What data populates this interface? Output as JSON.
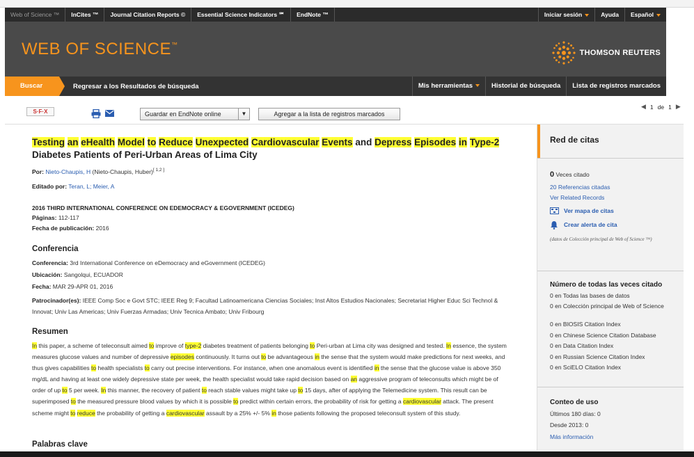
{
  "topbar": {
    "items": [
      "Web of Science ™",
      "InCites ™",
      "Journal Citation Reports ©",
      "Essential Science Indicators ℠",
      "EndNote ™"
    ],
    "signin": "Iniciar sesión",
    "help": "Ayuda",
    "language": "Español"
  },
  "banner": {
    "logo": "WEB OF SCIENCE",
    "logo_tm": "™",
    "brand": "THOMSON REUTERS"
  },
  "nav": {
    "search": "Buscar",
    "back": "Regresar a los Resultados de búsqueda",
    "tools": "Mis herramientas",
    "history": "Historial de búsqueda",
    "marked": "Lista de registros marcados"
  },
  "toolbar": {
    "sfx": "S·F·X",
    "save_select": "Guardar en EndNote online",
    "add_marked": "Agregar a la lista de registros marcados",
    "page_current": "1",
    "page_of": "de",
    "page_total": "1"
  },
  "record": {
    "title_parts": [
      {
        "t": "Testing",
        "hl": true
      },
      {
        "t": " ",
        "hl": false
      },
      {
        "t": "an",
        "hl": true
      },
      {
        "t": " ",
        "hl": false
      },
      {
        "t": "eHealth",
        "hl": true
      },
      {
        "t": " ",
        "hl": false
      },
      {
        "t": "Model",
        "hl": true
      },
      {
        "t": " ",
        "hl": false
      },
      {
        "t": "to",
        "hl": true
      },
      {
        "t": " ",
        "hl": false
      },
      {
        "t": "Reduce",
        "hl": true
      },
      {
        "t": " ",
        "hl": false
      },
      {
        "t": "Unexpected",
        "hl": true
      },
      {
        "t": " ",
        "hl": false
      },
      {
        "t": "Cardiovascular",
        "hl": true
      },
      {
        "t": " ",
        "hl": false
      },
      {
        "t": "Events",
        "hl": true
      },
      {
        "t": " and ",
        "hl": false
      },
      {
        "t": "Depress",
        "hl": true
      },
      {
        "t": " ",
        "hl": false
      },
      {
        "t": "Episodes",
        "hl": true
      },
      {
        "t": " ",
        "hl": false
      },
      {
        "t": "in",
        "hl": true
      },
      {
        "t": " ",
        "hl": false
      },
      {
        "t": "Type-2",
        "hl": true
      },
      {
        "t": " Diabetes Patients of Peri-Urban Areas of Lima City",
        "hl": false
      }
    ],
    "by_label": "Por:",
    "author": "Nieto-Chaupis, H",
    "author_full": "(Nieto-Chaupis, Huber)",
    "author_sup": "[ 1,2 ]",
    "edited_label": "Editado por:",
    "editors": "Teran, L; Meier, A",
    "conference_name": "2016 THIRD INTERNATIONAL CONFERENCE ON EDEMOCRACY & EGOVERNMENT (ICEDEG)",
    "pages_label": "Páginas:",
    "pages": "112-117",
    "pubdate_label": "Fecha de publicación:",
    "pubdate": "2016"
  },
  "conference": {
    "heading": "Conferencia",
    "conf_label": "Conferencia:",
    "conf_value": "3rd International Conference on eDemocracy and eGovernment (ICEDEG)",
    "location_label": "Ubicación:",
    "location_value": "Sangolqui, ECUADOR",
    "date_label": "Fecha:",
    "date_value": "MAR 29-APR 01, 2016",
    "sponsor_label": "Patrocinador(es):",
    "sponsor_value": "IEEE Comp Soc e Govt STC; IEEE Reg 9; Facultad Latinoamericana Ciencias Sociales; Inst Altos Estudios Nacionales; Secretariat Higher Educ Sci Technol & Innovat; Univ Las Americas; Univ Fuerzas Armadas; Univ Tecnica Ambato; Univ Fribourg"
  },
  "abstract": {
    "heading": "Resumen",
    "parts": [
      {
        "t": "In",
        "hl": true
      },
      {
        "t": " this paper, a scheme of teleconsult aimed ",
        "hl": false
      },
      {
        "t": "to",
        "hl": true
      },
      {
        "t": " improve of ",
        "hl": false
      },
      {
        "t": "type-2",
        "hl": true
      },
      {
        "t": " diabetes treatment of patients belonging ",
        "hl": false
      },
      {
        "t": "to",
        "hl": true
      },
      {
        "t": " Peri-urban at Lima city was designed and tested. ",
        "hl": false
      },
      {
        "t": "In",
        "hl": true
      },
      {
        "t": " essence, the system measures glucose values and number of depressive ",
        "hl": false
      },
      {
        "t": "episodes",
        "hl": true
      },
      {
        "t": " continuously. It turns out ",
        "hl": false
      },
      {
        "t": "to",
        "hl": true
      },
      {
        "t": " be advantageous ",
        "hl": false
      },
      {
        "t": "in",
        "hl": true
      },
      {
        "t": " the sense that the system would make predictions for next weeks, and thus gives capabilities ",
        "hl": false
      },
      {
        "t": "to",
        "hl": true
      },
      {
        "t": " health specialists ",
        "hl": false
      },
      {
        "t": "to",
        "hl": true
      },
      {
        "t": " carry out precise interventions. For instance, when one anomalous event is identified ",
        "hl": false
      },
      {
        "t": "in",
        "hl": true
      },
      {
        "t": " the sense that the glucose value is above 350 mg/dL and having at least one widely depressive state per week, the health specialist would take rapid decision based on ",
        "hl": false
      },
      {
        "t": "an",
        "hl": true
      },
      {
        "t": " aggressive program of teleconsults which might be of order of up ",
        "hl": false
      },
      {
        "t": "to",
        "hl": true
      },
      {
        "t": " 5 per week. ",
        "hl": false
      },
      {
        "t": "In",
        "hl": true
      },
      {
        "t": " this manner, the recovery of patient ",
        "hl": false
      },
      {
        "t": "to",
        "hl": true
      },
      {
        "t": " reach stable values might take up ",
        "hl": false
      },
      {
        "t": "to",
        "hl": true
      },
      {
        "t": " 15 days, after of applying the Telemedicine system. This result can be superimposed ",
        "hl": false
      },
      {
        "t": "to",
        "hl": true
      },
      {
        "t": " the measured pressure blood values by which it is possible ",
        "hl": false
      },
      {
        "t": "to",
        "hl": true
      },
      {
        "t": " predict within certain errors, the probability of risk for getting a ",
        "hl": false
      },
      {
        "t": "cardiovascular",
        "hl": true
      },
      {
        "t": " attack. The present scheme might ",
        "hl": false
      },
      {
        "t": "to",
        "hl": true
      },
      {
        "t": " ",
        "hl": false
      },
      {
        "t": "reduce",
        "hl": true
      },
      {
        "t": " the probability of getting a ",
        "hl": false
      },
      {
        "t": "cardiovascular",
        "hl": true
      },
      {
        "t": " assault by a 25% +/- 5% ",
        "hl": false
      },
      {
        "t": "in",
        "hl": true
      },
      {
        "t": " those patients following the proposed teleconsult system of this study.",
        "hl": false
      }
    ]
  },
  "keywords": {
    "heading": "Palabras clave"
  },
  "sidebar": {
    "heading": "Red de citas",
    "times_cited_count": "0",
    "times_cited_label": "Veces citado",
    "cited_refs": "20 Referencias citadas",
    "related": "Ver Related Records",
    "citation_map": "Ver mapa de citas",
    "alert": "Crear alerta de cita",
    "note": "(datos de Colección principal de Web of Science ™)",
    "all_cited_heading": "Número de todas las veces citado",
    "db_counts": [
      "0 en Todas las bases de datos",
      "0 en Colección principal de Web of Science",
      "0 en BIOSIS Citation Index",
      "0 en Chinese Science Citation Database",
      "0 en Data Citation Index",
      "0 en Russian Science Citation Index",
      "0 en SciELO Citation Index"
    ],
    "usage_heading": "Conteo de uso",
    "usage_180": "Últimos 180 días: 0",
    "usage_2013": "Desde 2013: 0",
    "more_info": "Más información"
  },
  "colors": {
    "accent": "#f7941d",
    "highlight": "#ffff33",
    "link": "#2a5db0"
  }
}
